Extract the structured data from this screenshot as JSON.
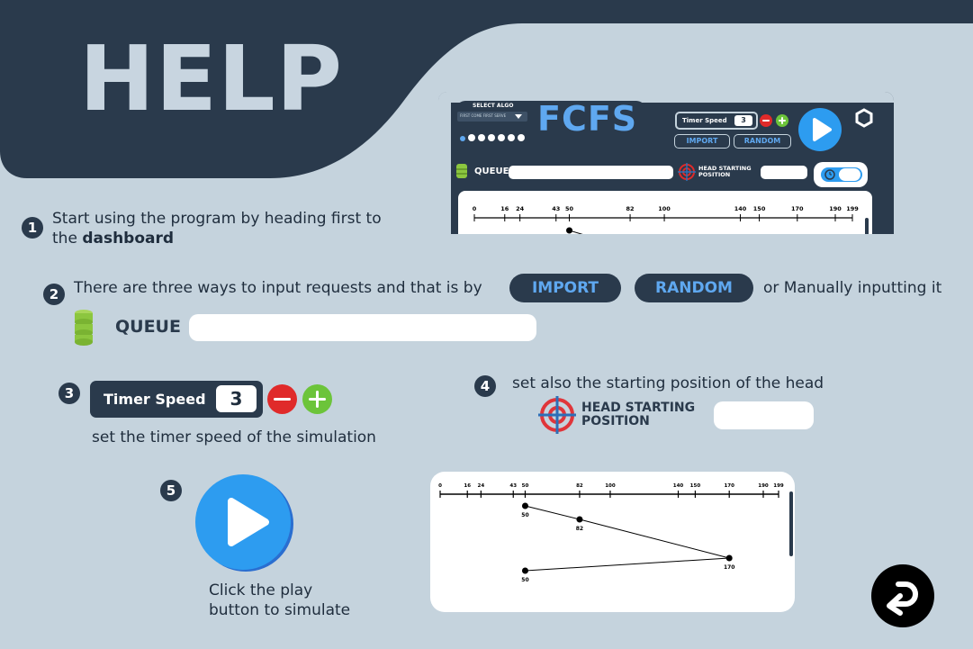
{
  "header": {
    "title": "HELP"
  },
  "preview": {
    "select_algo_label": "SELECT ALGO",
    "algo_dropdown": "FIRST COME FIRST SERVE",
    "algo_title": "FCFS",
    "timer_speed_label": "Timer Speed",
    "timer_speed_value": "3",
    "import_label": "IMPORT",
    "random_label": "RANDOM",
    "queue_label": "QUEUE",
    "head_label_line1": "HEAD STARTING",
    "head_label_line2": "POSITION",
    "ticks": [
      0,
      16,
      24,
      43,
      50,
      82,
      100,
      140,
      150,
      170,
      190,
      199
    ],
    "tick_labels": [
      "0",
      "16",
      "24",
      "43",
      "50",
      "82",
      "100",
      "140",
      "150",
      "170",
      "190",
      "199"
    ]
  },
  "steps": {
    "s1": {
      "num": "1",
      "text_a": "Start using the program by heading first to",
      "text_b": "the ",
      "text_b_bold": "dashboard"
    },
    "s2": {
      "num": "2",
      "text_a": "There are three ways to input requests and that is by",
      "import_label": "IMPORT",
      "random_label": "RANDOM",
      "text_b": "or Manually inputting it",
      "queue_label": "QUEUE"
    },
    "s3": {
      "num": "3",
      "timer_speed_label": "Timer Speed",
      "timer_speed_value": "3",
      "text": "set the timer speed of the simulation"
    },
    "s4": {
      "num": "4",
      "text": "set also the starting position of the head",
      "head_label_line1": "HEAD STARTING",
      "head_label_line2": "POSITION"
    },
    "s5": {
      "num": "5",
      "text_a": "Click the play",
      "text_b": "button to simulate"
    }
  },
  "chart_data": {
    "type": "line",
    "title": "",
    "xlabel": "",
    "ylabel": "",
    "x_ticks": [
      0,
      16,
      24,
      43,
      50,
      82,
      100,
      140,
      150,
      170,
      190,
      199
    ],
    "x_tick_labels": [
      "0",
      "16",
      "24",
      "43",
      "50",
      "82",
      "100",
      "140",
      "150",
      "170",
      "190",
      "199"
    ],
    "xlim": [
      0,
      199
    ],
    "series": [
      {
        "x": [
          50,
          82,
          170,
          50
        ],
        "point_labels": [
          "50",
          "82",
          "170",
          "50"
        ]
      }
    ],
    "grid": false
  },
  "colors": {
    "background": "#c5d3dd",
    "dark": "#2a3a4c",
    "accent_blue": "#5fa8f0",
    "play_blue": "#2d9cf0",
    "minus_red": "#e02a2a",
    "plus_green": "#6cc43a",
    "queue_green": "#8cc63f"
  }
}
